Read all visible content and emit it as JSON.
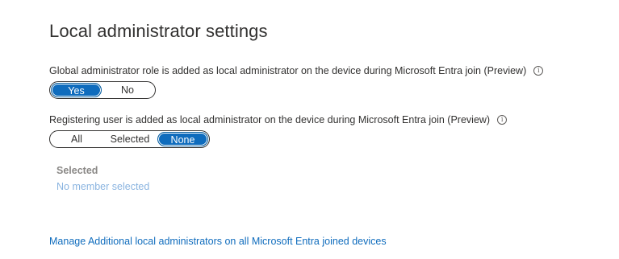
{
  "page": {
    "title": "Local administrator settings"
  },
  "global_admin": {
    "label": "Global administrator role is added as local administrator on the device during Microsoft Entra join (Preview)",
    "options": [
      "Yes",
      "No"
    ],
    "selected": "Yes"
  },
  "registering_user": {
    "label": "Registering user is added as local administrator on the device during Microsoft Entra join (Preview)",
    "options": [
      "All",
      "Selected",
      "None"
    ],
    "selected": "None"
  },
  "selected_section": {
    "heading": "Selected",
    "value": "No member selected"
  },
  "links": {
    "manage": "Manage Additional local administrators on all Microsoft Entra joined devices"
  },
  "icons": {
    "info": "info-icon"
  },
  "colors": {
    "accent": "#0f6cbd",
    "link": "#0f6cbd",
    "disabled_link": "#8ab4e0"
  }
}
